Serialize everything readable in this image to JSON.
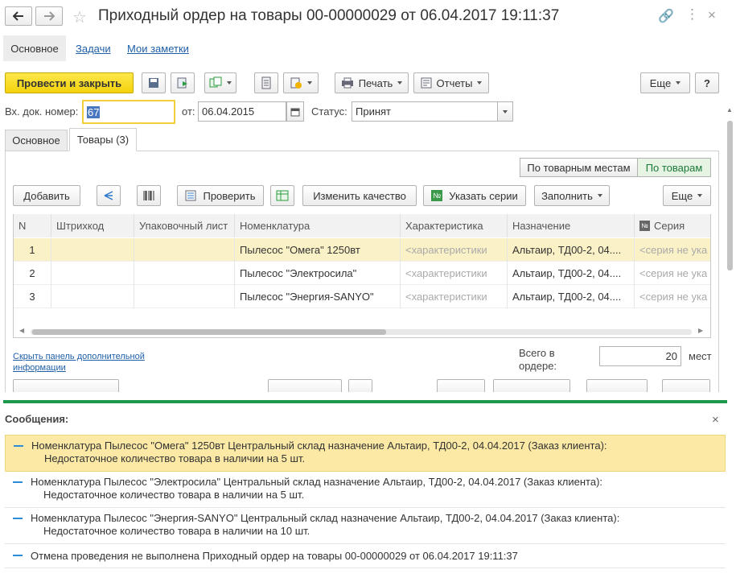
{
  "window": {
    "title": "Приходный ордер на товары 00-00000029 от 06.04.2017 19:11:37"
  },
  "nav_tabs": [
    "Основное",
    "Задачи",
    "Мои заметки"
  ],
  "toolbar": {
    "post_close": "Провести и закрыть",
    "print": "Печать",
    "reports": "Отчеты",
    "more": "Еще",
    "help": "?"
  },
  "header": {
    "doc_num_label": "Вх. док. номер:",
    "doc_num_value": "67",
    "date_label": "от:",
    "date_value": "06.04.2015",
    "status_label": "Статус:",
    "status_value": "Принят"
  },
  "content_tabs": [
    "Основное",
    "Товары (3)"
  ],
  "view_toggle": [
    "По товарным местам",
    "По товарам"
  ],
  "table_toolbar": {
    "add": "Добавить",
    "check": "Проверить",
    "change_quality": "Изменить качество",
    "specify_series": "Указать серии",
    "fill": "Заполнить",
    "more": "Еще"
  },
  "table": {
    "columns": [
      "N",
      "Штрихкод",
      "Упаковочный лист",
      "Номенклатура",
      "Характеристика",
      "Назначение",
      "Серия"
    ],
    "rows": [
      [
        "1",
        "",
        "",
        "Пылесос \"Омега\" 1250вт",
        "<характеристики",
        "Альтаир, ТД00-2, 04....",
        "<серия не ука"
      ],
      [
        "2",
        "",
        "",
        "Пылесос \"Электросила\"",
        "<характеристики",
        "Альтаир, ТД00-2, 04....",
        "<серия не ука"
      ],
      [
        "3",
        "",
        "",
        "Пылесос \"Энергия-SANYO\"",
        "<характеристики",
        "Альтаир, ТД00-2, 04....",
        "<серия не ука"
      ]
    ]
  },
  "footer": {
    "hide_panel_line1": "Скрыть панель дополнительной",
    "hide_panel_line2": "информации",
    "total_label_line1": "Всего в",
    "total_label_line2": "ордере:",
    "total_value": "20",
    "unit": "мест"
  },
  "messages": {
    "title": "Сообщения:",
    "items": [
      {
        "line1": "Номенклатура Пылесос \"Омега\" 1250вт Центральный склад назначение Альтаир, ТД00-2, 04.04.2017 (Заказ клиента):",
        "line2": "Недостаточное количество товара в наличии на 5 шт."
      },
      {
        "line1": "Номенклатура Пылесос \"Электросила\" Центральный склад назначение Альтаир, ТД00-2, 04.04.2017 (Заказ клиента):",
        "line2": "Недостаточное количество товара в наличии на 5 шт."
      },
      {
        "line1": "Номенклатура Пылесос \"Энергия-SANYO\" Центральный склад назначение Альтаир, ТД00-2, 04.04.2017 (Заказ клиента):",
        "line2": "Недостаточное количество товара в наличии на 10 шт."
      },
      {
        "line1": "Отмена проведения не выполнена Приходный ордер на товары 00-00000029 от 06.04.2017 19:11:37",
        "line2": ""
      }
    ]
  },
  "colors": {
    "accent_yellow": "#f5d311",
    "selected_row": "#fbf1c7",
    "green_divider": "#1a9a4a",
    "link": "#1f5fa8",
    "message_highlight": "#fbe9a5"
  }
}
